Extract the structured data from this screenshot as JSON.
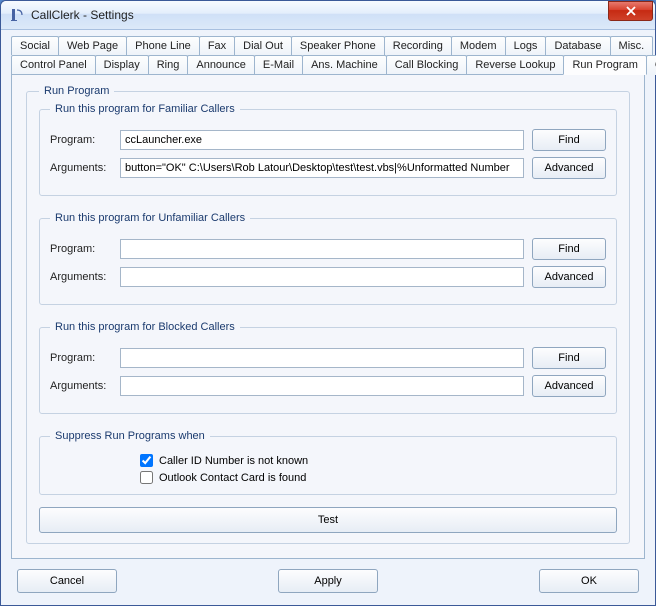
{
  "window": {
    "title": "CallClerk - Settings"
  },
  "tabs_row1": [
    "Social",
    "Web Page",
    "Phone Line",
    "Fax",
    "Dial Out",
    "Speaker Phone",
    "Recording",
    "Modem",
    "Logs",
    "Database",
    "Misc."
  ],
  "tabs_row2": [
    "Control Panel",
    "Display",
    "Ring",
    "Announce",
    "E-Mail",
    "Ans. Machine",
    "Call Blocking",
    "Reverse Lookup",
    "Run Program",
    "Outlook"
  ],
  "active_tab": "Run Program",
  "main_group": "Run Program",
  "groups": {
    "familiar": {
      "legend": "Run this program for Familiar Callers",
      "program_label": "Program:",
      "program_value": "ccLauncher.exe",
      "arguments_label": "Arguments:",
      "arguments_value": "button=\"OK\" C:\\Users\\Rob Latour\\Desktop\\test\\test.vbs|%Unformatted Number",
      "find": "Find",
      "advanced": "Advanced"
    },
    "unfamiliar": {
      "legend": "Run this program for Unfamiliar Callers",
      "program_label": "Program:",
      "program_value": "",
      "arguments_label": "Arguments:",
      "arguments_value": "",
      "find": "Find",
      "advanced": "Advanced"
    },
    "blocked": {
      "legend": "Run this program for Blocked Callers",
      "program_label": "Program:",
      "program_value": "",
      "arguments_label": "Arguments:",
      "arguments_value": "",
      "find": "Find",
      "advanced": "Advanced"
    },
    "suppress": {
      "legend": "Suppress Run Programs when",
      "opt1_label": "Caller ID Number is not known",
      "opt1_checked": true,
      "opt2_label": "Outlook Contact Card is found",
      "opt2_checked": false
    }
  },
  "buttons": {
    "test": "Test",
    "cancel": "Cancel",
    "apply": "Apply",
    "ok": "OK"
  }
}
